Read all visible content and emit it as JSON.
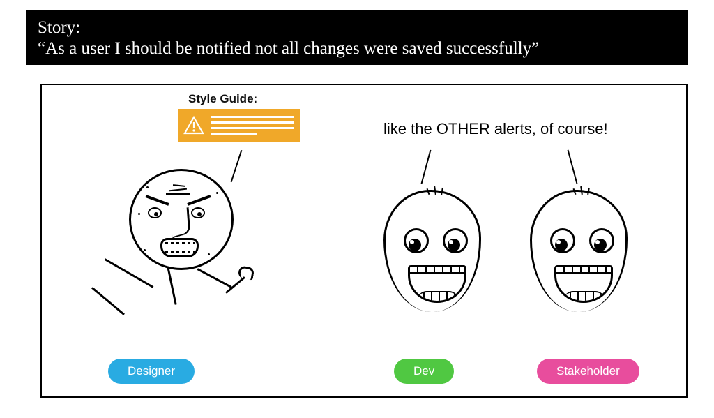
{
  "story": {
    "label": "Story:",
    "text": "“As a user I should be notified not all changes were saved successfully”"
  },
  "panel": {
    "style_guide_label": "Style Guide:",
    "reply_text": "like the OTHER alerts, of course!"
  },
  "labels": {
    "designer": "Designer",
    "dev": "Dev",
    "stakeholder": "Stakeholder"
  },
  "colors": {
    "designer_pill": "#29abe2",
    "dev_pill": "#50c842",
    "stakeholder_pill": "#e84d9d",
    "alert_bg": "#f0a829"
  }
}
